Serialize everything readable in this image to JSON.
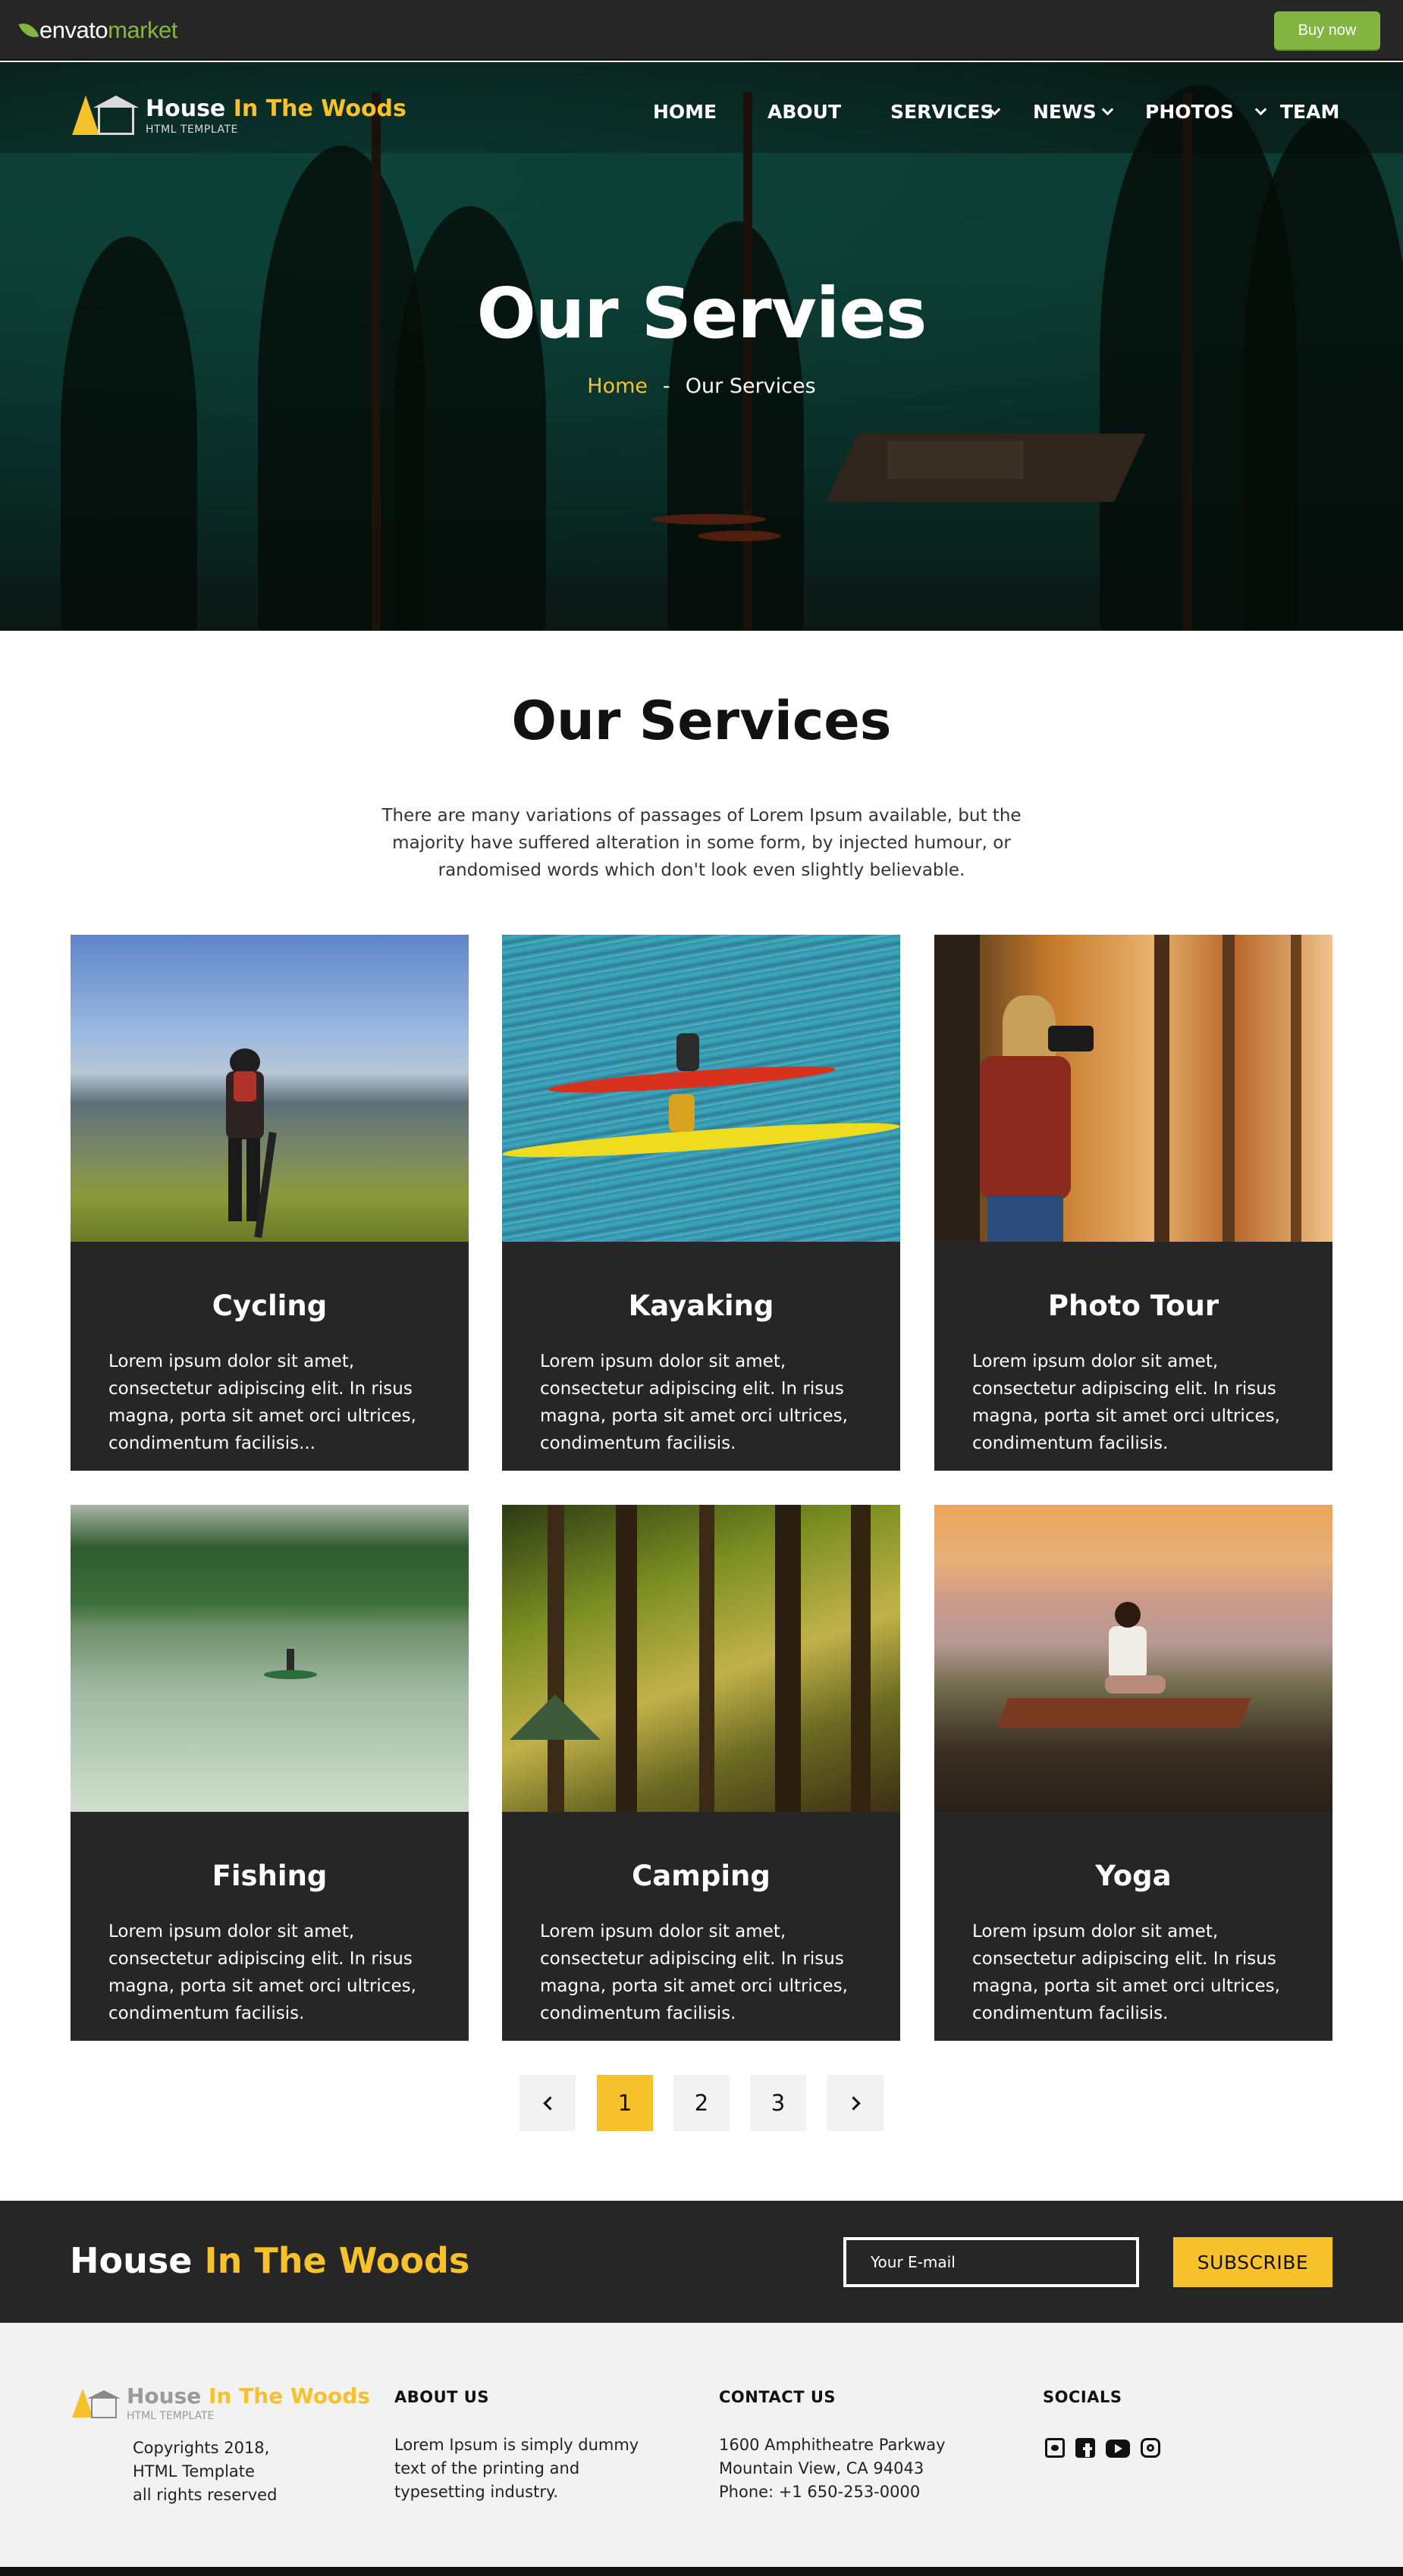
{
  "envato": {
    "logo_word": "envato",
    "logo_market": "market",
    "buy_now": "Buy now",
    "accent_color": "#82b541"
  },
  "brand": {
    "name_white": "House ",
    "name_accent": "In The Woods",
    "subtitle": "HTML TEMPLATE",
    "accent_color": "#f7c12c"
  },
  "nav": {
    "home": "HOME",
    "about": "ABOUT",
    "services": "SERVICES",
    "news": "NEWS",
    "photos": "PHOTOS",
    "team": "TEAM"
  },
  "hero": {
    "title": "Our Servies",
    "breadcrumb_home": "Home",
    "breadcrumb_sep": "-",
    "breadcrumb_current": "Our Services"
  },
  "services": {
    "title": "Our Services",
    "description": "There are many variations of passages of Lorem Ipsum available, but the majority have suffered alteration in some form, by injected humour, or randomised words which don't look even slightly believable.",
    "cards": [
      {
        "title": "Cycling",
        "text": "Lorem ipsum dolor sit amet, consectetur adipiscing elit. In risus magna, porta sit amet orci ultrices, condimentum facilisis..."
      },
      {
        "title": "Kayaking",
        "text": "Lorem ipsum dolor sit amet, consectetur adipiscing elit. In risus magna, porta sit amet orci ultrices, condimentum facilisis."
      },
      {
        "title": "Photo Tour",
        "text": "Lorem ipsum dolor sit amet, consectetur adipiscing elit. In risus magna, porta sit amet orci ultrices, condimentum facilisis."
      },
      {
        "title": "Fishing",
        "text": "Lorem ipsum dolor sit amet, consectetur adipiscing elit. In risus magna, porta sit amet orci ultrices, condimentum facilisis."
      },
      {
        "title": "Camping",
        "text": "Lorem ipsum dolor sit amet, consectetur adipiscing elit. In risus magna, porta sit amet orci ultrices, condimentum facilisis."
      },
      {
        "title": "Yoga",
        "text": "Lorem ipsum dolor sit amet, consectetur adipiscing elit. In risus magna, porta sit amet orci ultrices, condimentum facilisis."
      }
    ]
  },
  "pagination": {
    "pages": [
      "1",
      "2",
      "3"
    ],
    "current": "1"
  },
  "subscribe": {
    "brand_white": "House ",
    "brand_accent": "In The Woods",
    "email_placeholder": "Your E-mail",
    "button": "SUBSCRIBE"
  },
  "footer": {
    "copyright_lines": [
      "Copyrights 2018,",
      "HTML Template",
      "all rights reserved"
    ],
    "about_title": "ABOUT US",
    "about_lines": [
      "Lorem Ipsum is simply dummy",
      "text of the printing and",
      "typesetting industry."
    ],
    "contact_title": "CONTACT US",
    "contact_lines": [
      "1600 Amphitheatre Parkway",
      "Mountain View, CA 94043",
      "Phone: +1 650-253-0000"
    ],
    "socials_title": "SOCIALS",
    "social_icons": [
      "twitter-icon",
      "facebook-icon",
      "youtube-icon",
      "instagram-icon"
    ]
  }
}
